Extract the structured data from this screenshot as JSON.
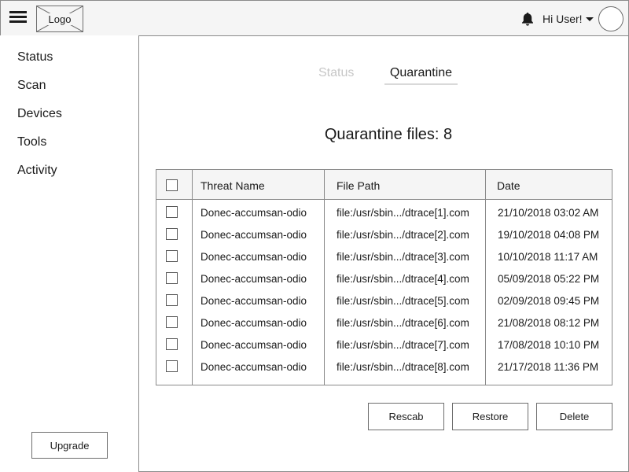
{
  "header": {
    "logo": "Logo",
    "user_greeting": "Hi User!"
  },
  "sidebar": {
    "items": [
      {
        "label": "Status"
      },
      {
        "label": "Scan"
      },
      {
        "label": "Devices"
      },
      {
        "label": "Tools"
      },
      {
        "label": "Activity"
      }
    ],
    "upgrade_label": "Upgrade"
  },
  "tabs": [
    {
      "label": "Status",
      "active": false
    },
    {
      "label": "Quarantine",
      "active": true
    }
  ],
  "main": {
    "title": "Quarantine files: 8"
  },
  "table": {
    "columns": [
      "Threat Name",
      "File Path",
      "Date"
    ],
    "rows": [
      {
        "threat": "Donec-accumsan-odio",
        "path": "file:/usr/sbin.../dtrace[1].com",
        "date": "21/10/2018 03:02 AM"
      },
      {
        "threat": "Donec-accumsan-odio",
        "path": "file:/usr/sbin.../dtrace[2].com",
        "date": "19/10/2018 04:08 PM"
      },
      {
        "threat": "Donec-accumsan-odio",
        "path": "file:/usr/sbin.../dtrace[3].com",
        "date": "10/10/2018 11:17 AM"
      },
      {
        "threat": "Donec-accumsan-odio",
        "path": "file:/usr/sbin.../dtrace[4].com",
        "date": "05/09/2018 05:22 PM"
      },
      {
        "threat": "Donec-accumsan-odio",
        "path": "file:/usr/sbin.../dtrace[5].com",
        "date": "02/09/2018 09:45 PM"
      },
      {
        "threat": "Donec-accumsan-odio",
        "path": "file:/usr/sbin.../dtrace[6].com",
        "date": "21/08/2018 08:12 PM"
      },
      {
        "threat": "Donec-accumsan-odio",
        "path": "file:/usr/sbin.../dtrace[7].com",
        "date": "17/08/2018 10:10 PM"
      },
      {
        "threat": "Donec-accumsan-odio",
        "path": "file:/usr/sbin.../dtrace[8].com",
        "date": "21/17/2018 11:36 PM"
      }
    ]
  },
  "actions": {
    "rescan_label": "Rescab",
    "restore_label": "Restore",
    "delete_label": "Delete"
  },
  "icons": {
    "menu": "hamburger-menu-icon",
    "notifications": "bell-icon",
    "user_menu_caret": "caret-down-icon",
    "avatar": "avatar-placeholder"
  }
}
